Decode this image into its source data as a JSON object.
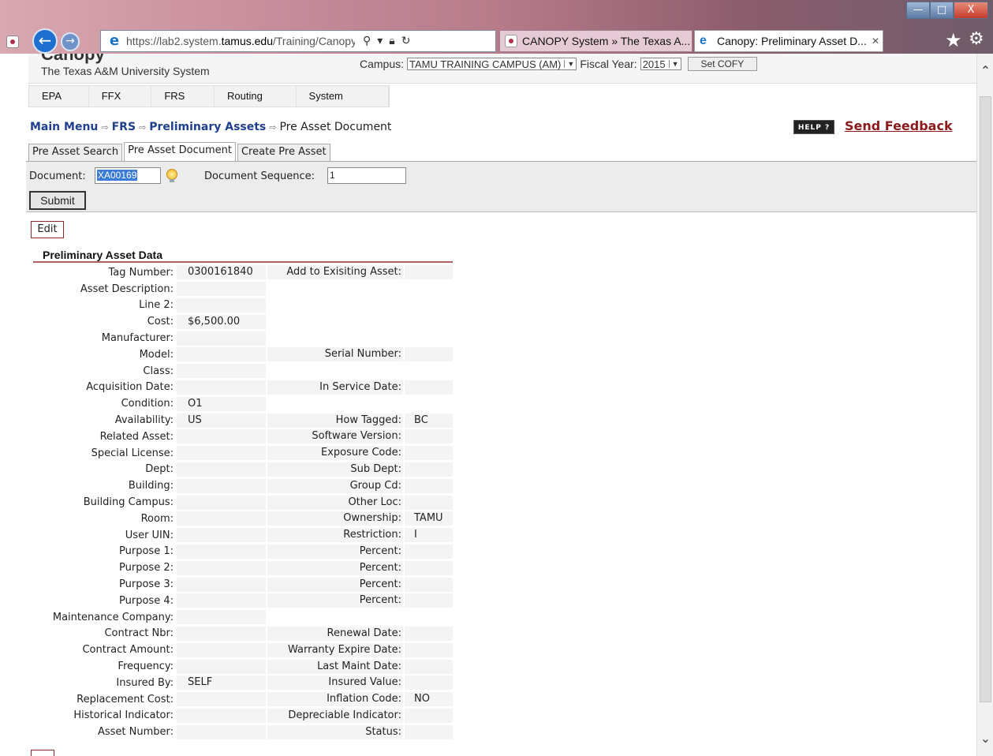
{
  "browser": {
    "url_prefix": "https://lab2.system.",
    "url_domain": "tamus.edu",
    "url_suffix": "/Training/CanopyTwo/Mo",
    "tabs": [
      {
        "title": "CANOPY System » The Texas A..."
      },
      {
        "title": "Canopy: Preliminary Asset D..."
      }
    ],
    "window_controls": {
      "minimize": "—",
      "maximize": "□",
      "close": "X"
    }
  },
  "header": {
    "logo": "Canopy",
    "org": "The Texas A&M University System",
    "campus_label": "Campus:",
    "campus_value": "TAMU TRAINING CAMPUS (AM)",
    "fiscal_label": "Fiscal Year:",
    "fiscal_value": "2015",
    "set_button": "Set COFY"
  },
  "menu": [
    "EPA",
    "FFX",
    "FRS",
    "Routing",
    "System"
  ],
  "breadcrumb": {
    "items": [
      "Main Menu",
      "FRS",
      "Preliminary Assets"
    ],
    "current": "Pre Asset Document",
    "separator": "⇨"
  },
  "help_label": "HELP ?",
  "feedback_label": "Send Feedback",
  "tabs": [
    "Pre Asset Search",
    "Pre Asset Document",
    "Create Pre Asset"
  ],
  "docbar": {
    "document_label": "Document:",
    "document_value": "XA00169",
    "sequence_label": "Document Sequence:",
    "sequence_value": "1",
    "submit_label": "Submit"
  },
  "edit_label": "Edit",
  "section_title": "Preliminary Asset Data",
  "rows": [
    [
      "Tag Number:",
      "0300161840",
      "Add to Exisiting Asset:",
      ""
    ],
    [
      "Asset Description:",
      "",
      "",
      ""
    ],
    [
      "Line 2:",
      "",
      "",
      ""
    ],
    [
      "Cost:",
      "$6,500.00",
      "",
      ""
    ],
    [
      "Manufacturer:",
      "",
      "",
      ""
    ],
    [
      "Model:",
      "",
      "Serial Number:",
      ""
    ],
    [
      "Class:",
      "",
      "",
      ""
    ],
    [
      "Acquisition Date:",
      "",
      "In Service Date:",
      ""
    ],
    [
      "Condition:",
      "O1",
      "",
      ""
    ],
    [
      "Availability:",
      "US",
      "How Tagged:",
      "BC"
    ],
    [
      "Related Asset:",
      "",
      "Software Version:",
      ""
    ],
    [
      "Special License:",
      "",
      "Exposure Code:",
      ""
    ],
    [
      "Dept:",
      "",
      "Sub Dept:",
      ""
    ],
    [
      "Building:",
      "",
      "Group Cd:",
      ""
    ],
    [
      "Building Campus:",
      "",
      "Other Loc:",
      ""
    ],
    [
      "Room:",
      "",
      "Ownership:",
      "TAMU"
    ],
    [
      "User UIN:",
      "",
      "Restriction:",
      "I"
    ],
    [
      "Purpose 1:",
      "",
      "Percent:",
      ""
    ],
    [
      "Purpose 2:",
      "",
      "Percent:",
      ""
    ],
    [
      "Purpose 3:",
      "",
      "Percent:",
      ""
    ],
    [
      "Purpose 4:",
      "",
      "Percent:",
      ""
    ],
    [
      "Maintenance Company:",
      "",
      "",
      ""
    ],
    [
      "Contract Nbr:",
      "",
      "Renewal Date:",
      ""
    ],
    [
      "Contract Amount:",
      "",
      "Warranty Expire Date:",
      ""
    ],
    [
      "Frequency:",
      "",
      "Last Maint Date:",
      ""
    ],
    [
      "Insured By:",
      "SELF",
      "Insured Value:",
      ""
    ],
    [
      "Replacement Cost:",
      "",
      "Inflation Code:",
      "NO"
    ],
    [
      "Historical Indicator:",
      "",
      "Depreciable Indicator:",
      ""
    ],
    [
      "Asset Number:",
      "",
      "Status:",
      ""
    ]
  ]
}
